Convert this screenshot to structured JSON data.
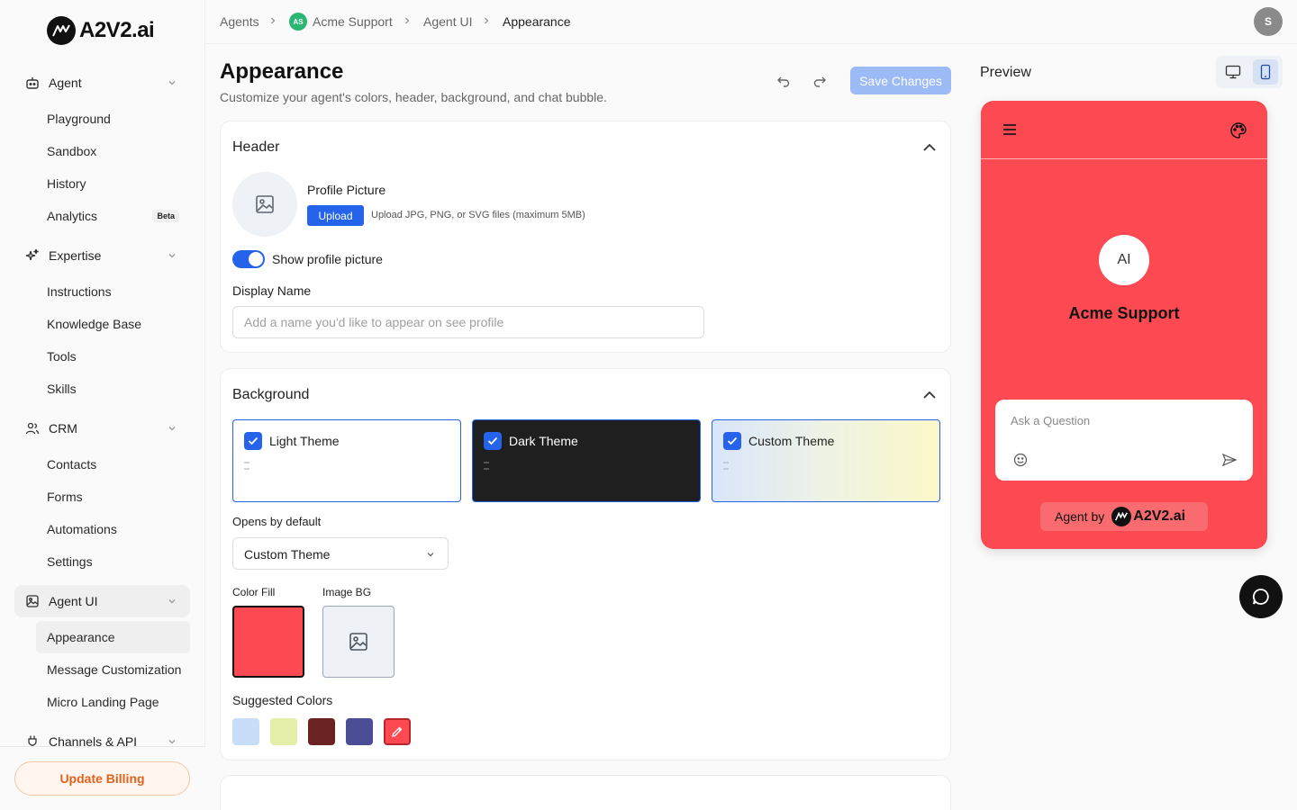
{
  "brand": {
    "logo_text": "A2V2.ai"
  },
  "sidebar": {
    "groups": [
      {
        "label": "Agent",
        "icon": "robot-icon"
      },
      {
        "label": "Expertise",
        "icon": "sparkles-icon"
      },
      {
        "label": "CRM",
        "icon": "users-icon"
      },
      {
        "label": "Agent UI",
        "icon": "image-icon"
      },
      {
        "label": "Channels & API",
        "icon": "plug-icon"
      }
    ],
    "agent_items": [
      "Playground",
      "Sandbox",
      "History",
      "Analytics"
    ],
    "analytics_badge": "Beta",
    "expertise_items": [
      "Instructions",
      "Knowledge Base",
      "Tools",
      "Skills"
    ],
    "crm_items": [
      "Contacts",
      "Forms",
      "Automations",
      "Settings"
    ],
    "agent_ui_items": [
      "Appearance",
      "Message Customization",
      "Micro Landing Page"
    ],
    "billing_label": "Update Billing"
  },
  "breadcrumb": {
    "items": [
      "Agents",
      "Acme Support",
      "Agent UI",
      "Appearance"
    ],
    "agent_badge": "AS"
  },
  "user": {
    "initial": "S"
  },
  "page": {
    "title": "Appearance",
    "subtitle": "Customize your agent's colors, header, background, and chat bubble.",
    "save_label": "Save Changes"
  },
  "header_section": {
    "title": "Header",
    "profile_picture_label": "Profile Picture",
    "upload_label": "Upload",
    "upload_hint": "Upload JPG, PNG, or SVG files (maximum 5MB)",
    "show_profile_label": "Show profile picture",
    "show_profile_enabled": true,
    "display_name_label": "Display Name",
    "display_name_value": "",
    "display_name_placeholder": "Add a name you'd like to appear on see profile"
  },
  "background_section": {
    "title": "Background",
    "themes": [
      {
        "label": "Light Theme",
        "checked": true
      },
      {
        "label": "Dark Theme",
        "checked": true
      },
      {
        "label": "Custom Theme",
        "checked": true
      }
    ],
    "opens_by_default_label": "Opens by default",
    "opens_by_default_value": "Custom Theme",
    "color_fill_label": "Color Fill",
    "image_bg_label": "Image BG",
    "color_fill_value": "#fd4a52",
    "suggested_colors_label": "Suggested Colors",
    "suggested_colors": [
      "#c8ddf8",
      "#e5efa9",
      "#6b2222",
      "#4b4e95",
      "#fd4a52"
    ]
  },
  "preview": {
    "title": "Preview",
    "avatar_initials": "AI",
    "agent_name": "Acme Support",
    "ask_placeholder": "Ask a Question",
    "powered_by_label": "Agent by",
    "powered_by_brand": "A2V2.ai"
  },
  "colors": {
    "accent": "#2563eb",
    "brand_red": "#fd4a52",
    "billing_orange": "#e2621b"
  }
}
